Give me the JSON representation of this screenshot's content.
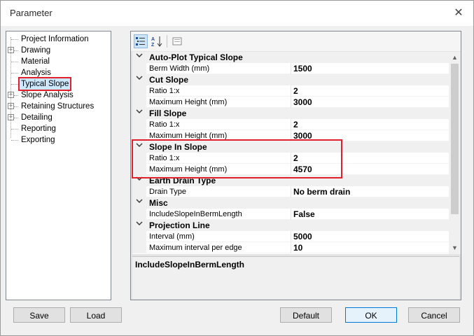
{
  "window": {
    "title": "Parameter",
    "close_glyph": "✕"
  },
  "tree": {
    "items": [
      {
        "label": "Project Information",
        "expandable": false,
        "selected": false
      },
      {
        "label": "Drawing",
        "expandable": true,
        "selected": false
      },
      {
        "label": "Material",
        "expandable": false,
        "selected": false
      },
      {
        "label": "Analysis",
        "expandable": false,
        "selected": false
      },
      {
        "label": "Typical Slope",
        "expandable": false,
        "selected": true
      },
      {
        "label": "Slope Analysis",
        "expandable": true,
        "selected": false
      },
      {
        "label": "Retaining Structures",
        "expandable": true,
        "selected": false
      },
      {
        "label": "Detailing",
        "expandable": true,
        "selected": false
      },
      {
        "label": "Reporting",
        "expandable": false,
        "selected": false
      },
      {
        "label": "Exporting",
        "expandable": false,
        "selected": false
      }
    ]
  },
  "toolbar": {
    "categorized_icon": "categorized-icon",
    "alphabetical_icon": "sort-az-icon",
    "property_pages_icon": "property-pages-icon"
  },
  "grid": {
    "rows": [
      {
        "type": "category",
        "label": "Auto-Plot Typical Slope"
      },
      {
        "type": "property",
        "name": "Berm Width (mm)",
        "value": "1500"
      },
      {
        "type": "category",
        "label": "Cut Slope"
      },
      {
        "type": "property",
        "name": "Ratio 1:x",
        "value": "2"
      },
      {
        "type": "property",
        "name": "Maximum Height (mm)",
        "value": "3000"
      },
      {
        "type": "category",
        "label": "Fill Slope"
      },
      {
        "type": "property",
        "name": "Ratio 1:x",
        "value": "2"
      },
      {
        "type": "property",
        "name": "Maximum Height (mm)",
        "value": "3000"
      },
      {
        "type": "category",
        "label": "Slope In Slope"
      },
      {
        "type": "property",
        "name": "Ratio 1:x",
        "value": "2"
      },
      {
        "type": "property",
        "name": "Maximum Height (mm)",
        "value": "4570"
      },
      {
        "type": "category",
        "label": "Earth Drain Type"
      },
      {
        "type": "property",
        "name": "Drain Type",
        "value": "No berm drain"
      },
      {
        "type": "category",
        "label": "Misc"
      },
      {
        "type": "property",
        "name": "IncludeSlopeInBermLength",
        "value": "False"
      },
      {
        "type": "category",
        "label": "Projection Line"
      },
      {
        "type": "property",
        "name": "Interval (mm)",
        "value": "5000"
      },
      {
        "type": "property",
        "name": "Maximum interval per edge",
        "value": "10"
      }
    ]
  },
  "description": {
    "title": "IncludeSlopeInBermLength"
  },
  "buttons": {
    "save": "Save",
    "load": "Load",
    "default": "Default",
    "ok": "OK",
    "cancel": "Cancel"
  }
}
